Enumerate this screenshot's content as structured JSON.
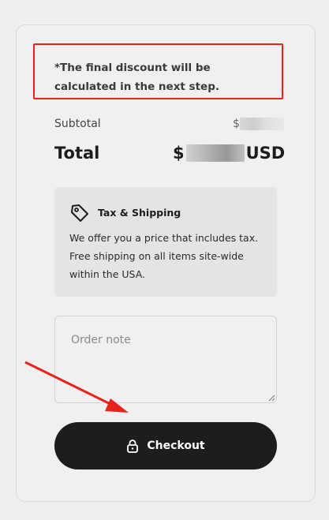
{
  "notice": {
    "text": "*The final discount will be calculated in the next step."
  },
  "summary": {
    "subtotal_label": "Subtotal",
    "subtotal_currency_symbol": "$",
    "total_label": "Total",
    "total_currency_symbol": "$",
    "total_currency_code": "USD"
  },
  "info": {
    "icon": "tag-icon",
    "title": "Tax & Shipping",
    "text": "We offer you a price that includes tax. Free shipping on all items site-wide within the USA."
  },
  "order_note": {
    "placeholder": "Order note",
    "value": ""
  },
  "checkout": {
    "icon": "lock-icon",
    "label": "Checkout"
  },
  "colors": {
    "annotation_red": "#e8231e",
    "button_bg": "#1d1d1d",
    "info_bg": "#e4e4e4"
  }
}
